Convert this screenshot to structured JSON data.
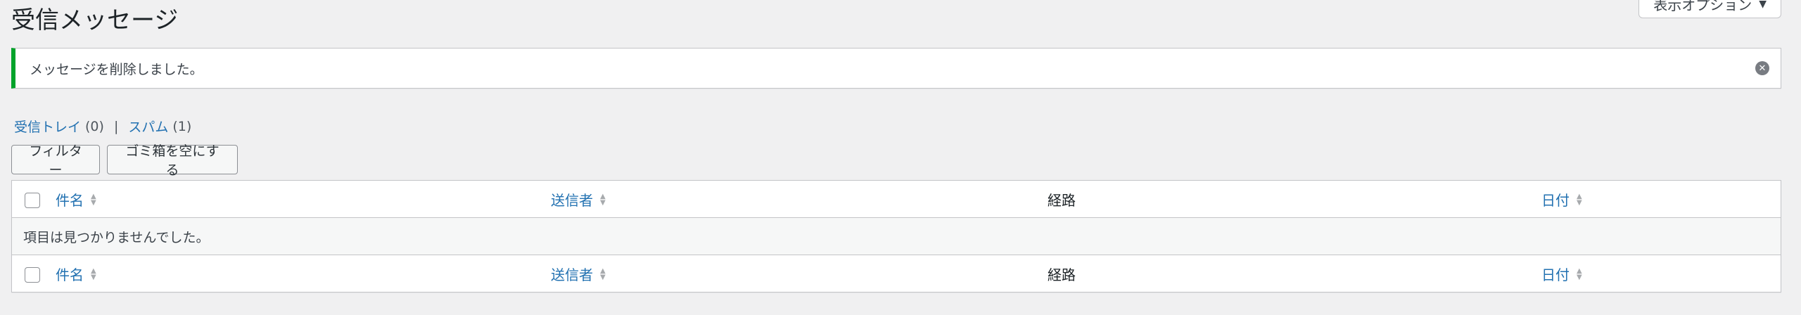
{
  "page": {
    "title": "受信メッセージ"
  },
  "screen_options": {
    "label": "表示オプション",
    "icon": "chevron-down-icon"
  },
  "notice": {
    "message": "メッセージを削除しました。",
    "accent_color": "#00a32a",
    "dismiss_icon": "close-circle-icon"
  },
  "views": {
    "inbox_label": "受信トレイ",
    "inbox_count": "(0)",
    "separator": "|",
    "spam_label": "スパム",
    "spam_count": "(1)"
  },
  "actions": {
    "filter_label": "フィルター",
    "empty_trash_label": "ゴミ箱を空にする"
  },
  "table": {
    "columns": {
      "subject": "件名",
      "from": "送信者",
      "via": "経路",
      "date": "日付"
    },
    "empty_message": "項目は見つかりませんでした。",
    "link_color": "#2271b1"
  }
}
